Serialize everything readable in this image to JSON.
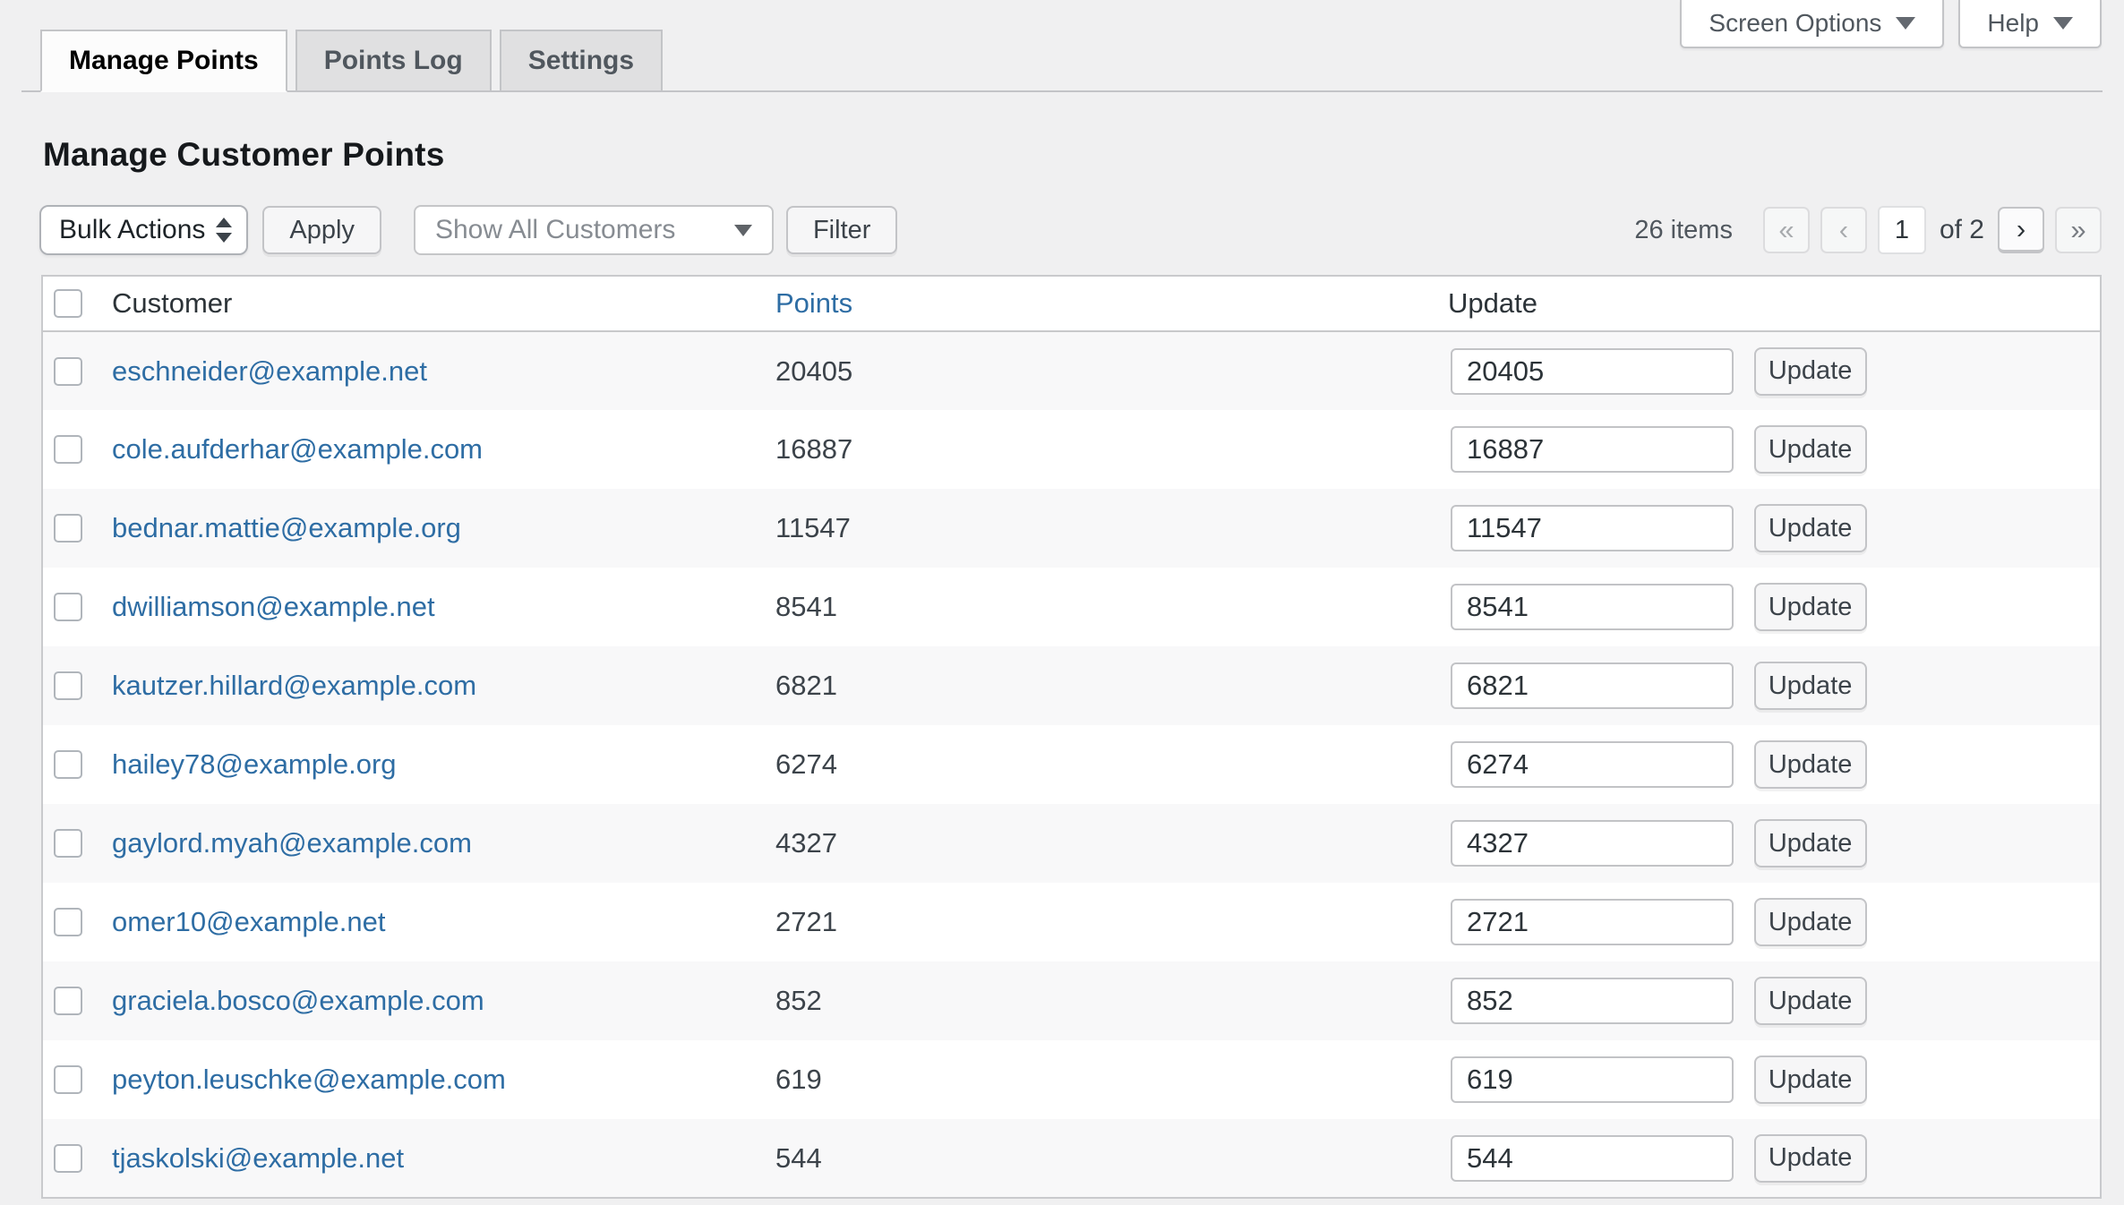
{
  "page_title": "Manage Customer Points",
  "top_links": {
    "screen_options": "Screen Options",
    "help": "Help"
  },
  "tabs": [
    {
      "label": "Manage Points",
      "active": true
    },
    {
      "label": "Points Log",
      "active": false
    },
    {
      "label": "Settings",
      "active": false
    }
  ],
  "toolbar": {
    "bulk_actions": "Bulk Actions",
    "apply": "Apply",
    "customer_filter": "Show All Customers",
    "filter": "Filter"
  },
  "pagination": {
    "items": "26 items",
    "first": "«",
    "prev": "‹",
    "current": "1",
    "of": "of 2",
    "next": "›",
    "last": "»"
  },
  "table": {
    "columns": {
      "customer": "Customer",
      "points": "Points",
      "update": "Update"
    },
    "update_label": "Update",
    "rows": [
      {
        "email": "eschneider@example.net",
        "points": "20405"
      },
      {
        "email": "cole.aufderhar@example.com",
        "points": "16887"
      },
      {
        "email": "bednar.mattie@example.org",
        "points": "11547"
      },
      {
        "email": "dwilliamson@example.net",
        "points": "8541"
      },
      {
        "email": "kautzer.hillard@example.com",
        "points": "6821"
      },
      {
        "email": "hailey78@example.org",
        "points": "6274"
      },
      {
        "email": "gaylord.myah@example.com",
        "points": "4327"
      },
      {
        "email": "omer10@example.net",
        "points": "2721"
      },
      {
        "email": "graciela.bosco@example.com",
        "points": "852"
      },
      {
        "email": "peyton.leuschke@example.com",
        "points": "619"
      },
      {
        "email": "tjaskolski@example.net",
        "points": "544"
      }
    ]
  },
  "colors": {
    "link_blue": "#2e6da4",
    "page_bg": "#f0f0f1",
    "stripe_bg": "#f8f8f9",
    "border_gray": "#c3c4c7",
    "text_dark": "#2c3338",
    "text_muted": "#50575e"
  }
}
